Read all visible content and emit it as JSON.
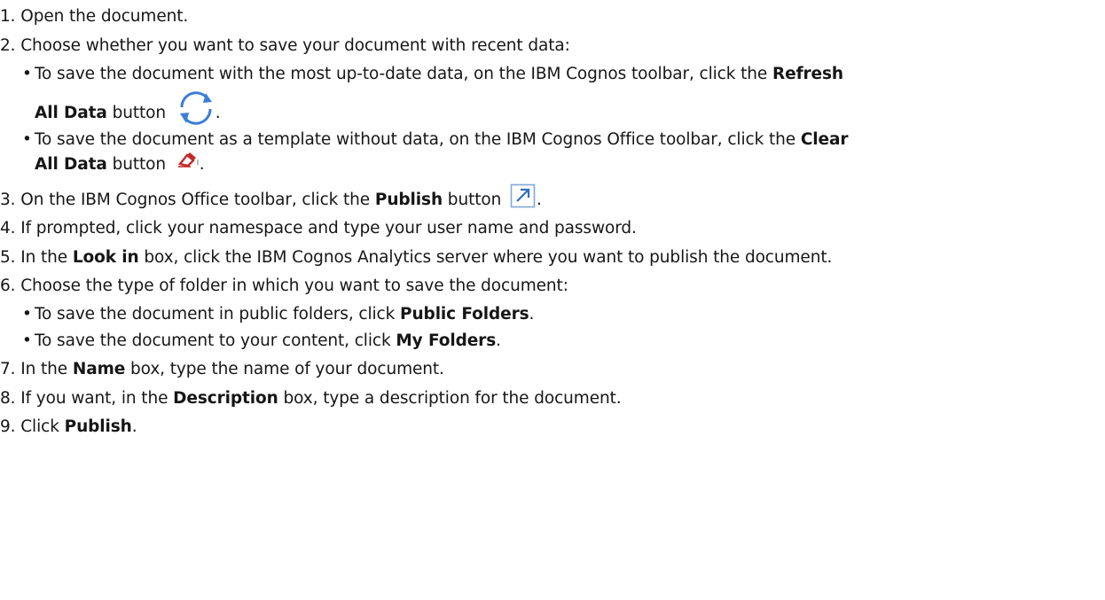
{
  "steps": [
    {
      "num": "1.",
      "text": "Open the document."
    },
    {
      "num": "2.",
      "text": "Choose whether you want to save your document with recent data:",
      "bullets": [
        {
          "pre": "To save the document with the most up-to-date data, on the IBM Cognos toolbar, click the ",
          "bold1": "Refresh",
          "bold2": "All Data",
          "post": " button",
          "end": ".",
          "icon": "refresh-icon"
        },
        {
          "pre": "To save the document as a template without data, on the IBM Cognos Office toolbar, click the ",
          "bold1": "Clear",
          "bold2": "All Data",
          "post": " button",
          "end": ".",
          "icon": "eraser-icon"
        }
      ]
    },
    {
      "num": "3.",
      "pre": "On the IBM Cognos Office toolbar, click the ",
      "bold": "Publish",
      "post": " button",
      "end": ".",
      "icon": "publish-icon"
    },
    {
      "num": "4.",
      "text": "If prompted, click your namespace and type your user name and password."
    },
    {
      "num": "5.",
      "pre": "In the ",
      "bold": "Look in",
      "post": " box, click the IBM Cognos Analytics server where you want to publish the document."
    },
    {
      "num": "6.",
      "text": "Choose the type of folder in which you want to save the document:",
      "bullets": [
        {
          "pre": "To save the document in public folders, click ",
          "bold": "Public Folders",
          "post": "."
        },
        {
          "pre": "To save the document to your content, click ",
          "bold": "My Folders",
          "post": "."
        }
      ]
    },
    {
      "num": "7.",
      "pre": "In the ",
      "bold": "Name",
      "post": " box, type the name of your document."
    },
    {
      "num": "8.",
      "pre": "If you want, in the ",
      "bold": "Description",
      "post": " box, type a description for the document."
    },
    {
      "num": "9.",
      "pre": "Click ",
      "bold": "Publish",
      "post": "."
    }
  ],
  "icon_colors": {
    "refresh": "#3b7dd8",
    "eraser": "#c62828",
    "publish": "#2f6fbf"
  }
}
